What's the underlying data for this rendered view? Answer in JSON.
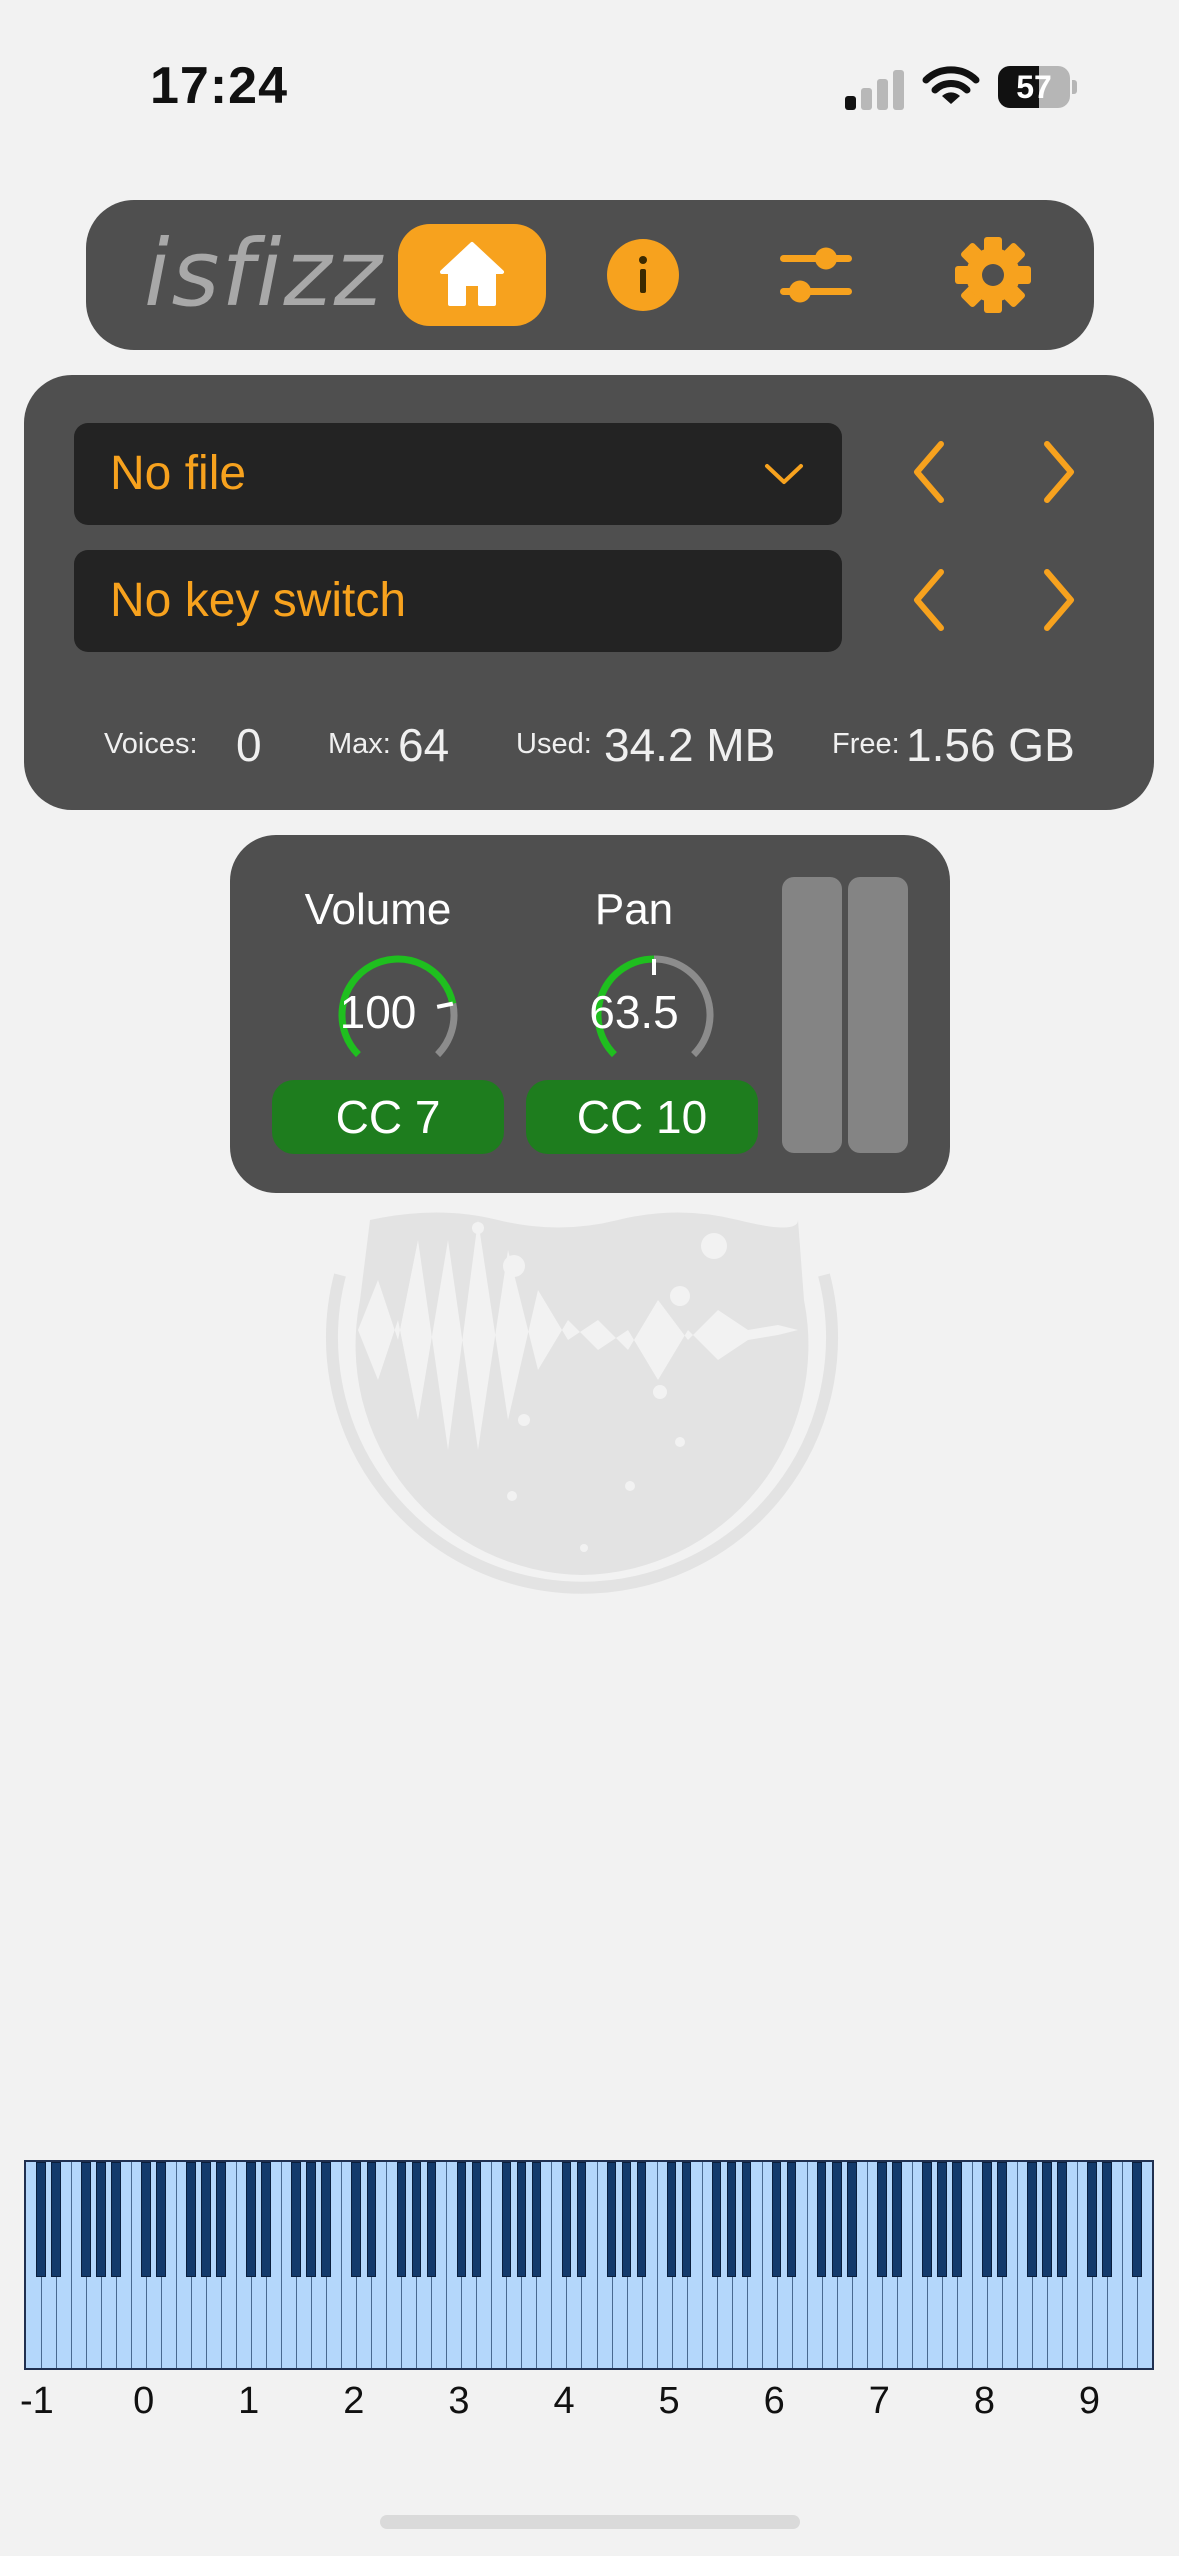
{
  "status_bar": {
    "time": "17:24",
    "battery_percent": "57",
    "icons": [
      "cellular-signal-icon",
      "wifi-icon",
      "battery-icon"
    ]
  },
  "nav": {
    "logo": "isfizz",
    "tabs": [
      {
        "name": "home",
        "icon": "home-icon",
        "active": true
      },
      {
        "name": "info",
        "icon": "info-icon",
        "active": false
      },
      {
        "name": "controls",
        "icon": "sliders-icon",
        "active": false
      },
      {
        "name": "settings",
        "icon": "gear-icon",
        "active": false
      }
    ]
  },
  "file_panel": {
    "file_select": "No file",
    "key_switch": "No key switch",
    "stats": {
      "voices_label": "Voices:",
      "voices_value": "0",
      "max_label": "Max:",
      "max_value": "64",
      "used_label": "Used:",
      "used_value": "34.2 MB",
      "free_label": "Free:",
      "free_value": "1.56 GB"
    }
  },
  "mixer": {
    "volume": {
      "label": "Volume",
      "value": "100",
      "cc": "CC 7",
      "fraction": 0.79
    },
    "pan": {
      "label": "Pan",
      "value": "63.5",
      "cc": "CC 10",
      "fraction": 0.5
    }
  },
  "keyboard": {
    "octave_labels": [
      "-1",
      "0",
      "1",
      "2",
      "3",
      "4",
      "5",
      "6",
      "7",
      "8",
      "9"
    ]
  },
  "colors": {
    "accent": "#f7a21e",
    "panel": "#4f4f4f",
    "field": "#232323",
    "cc_button": "#1e7d1e",
    "knob_active": "#1fbf1f",
    "white_key": "#b4d7fb",
    "black_key": "#133a6b"
  }
}
